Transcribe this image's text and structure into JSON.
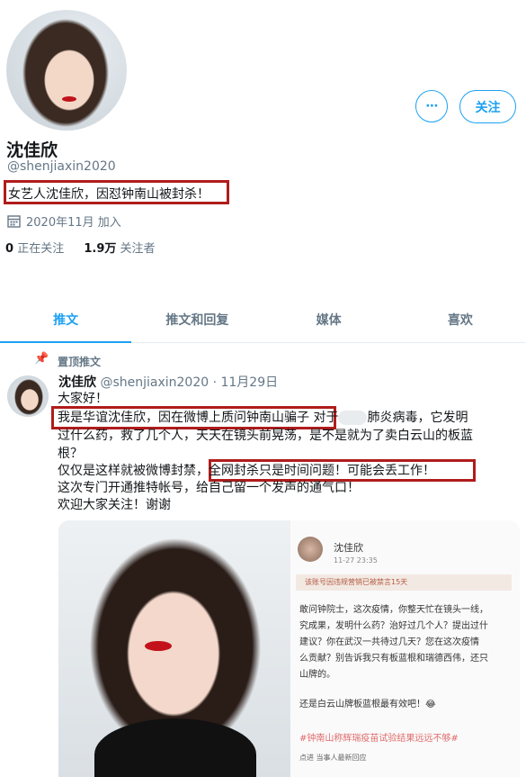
{
  "profile": {
    "display_name": "沈佳欣",
    "handle": "@shenjiaxin2020",
    "bio": "女艺人沈佳欣，因怼钟南山被封杀！",
    "joined": "2020年11月 加入",
    "following_count": "0",
    "following_label": "正在关注",
    "followers_count": "1.9万",
    "followers_label": "关注者",
    "more_label": "⋯",
    "follow_label": "关注"
  },
  "tabs": [
    {
      "label": "推文",
      "active": true
    },
    {
      "label": "推文和回复",
      "active": false
    },
    {
      "label": "媒体",
      "active": false
    },
    {
      "label": "喜欢",
      "active": false
    }
  ],
  "tweet": {
    "pinned_label": "置顶推文",
    "name": "沈佳欣",
    "handle_date": "@shenjiaxin2020 · 11月29日",
    "lines": [
      "大家好！",
      "我是华谊沈佳欣，因在微博上质问钟南山骗子  对于",
      "过什么药，救了几个人，天天在镜头前晃荡，是不是就为了卖白云山的板蓝",
      "根？",
      "仅仅是这样就被微博封禁，全网封杀只是时间问题！可能会丢工作！",
      "这次专门开通推特帐号，给自己留一个发声的通气口！",
      "欢迎大家关注！谢谢"
    ],
    "line2_tail": "肺炎病毒，它发明",
    "screenshot": {
      "name": "沈佳欣",
      "date": "11-27 23:35",
      "warning": "该账号因违规营销已被禁言15天",
      "body": [
        "敢问钟院士，这次疫情，你整天忙在镜头一线，",
        "究成果，发明什么药？治好过几个人？提出过什",
        "建议？你在武汉一共待过几天？您在这次疫情",
        "么贡献？别告诉我只有板蓝根和瑞德西伟，还只",
        "山牌的。",
        "还是白云山牌板蓝根最有效吧！😂"
      ],
      "hashtag": "#钟南山称辉瑞疫苗试验结果远远不够#",
      "reply_hint": "点进 当事人最新回应"
    }
  },
  "colors": {
    "accent": "#1da1f2",
    "highlight_box": "#b01c1c"
  }
}
